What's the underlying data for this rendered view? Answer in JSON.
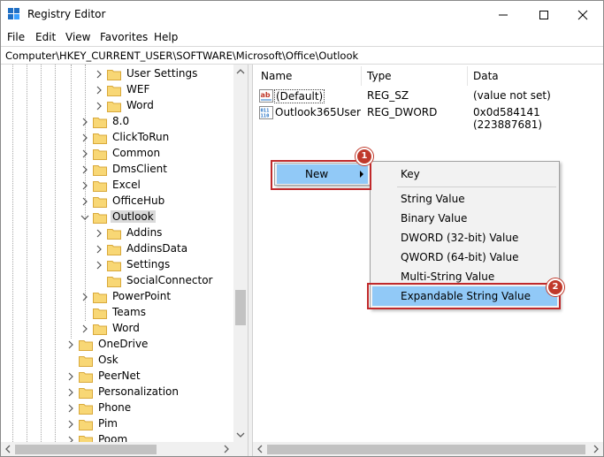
{
  "window": {
    "title": "Registry Editor",
    "app_icon": "registry-editor-icon"
  },
  "menu": [
    "File",
    "Edit",
    "View",
    "Favorites",
    "Help"
  ],
  "address": "Computer\\HKEY_CURRENT_USER\\SOFTWARE\\Microsoft\\Office\\Outlook",
  "tree": {
    "items": [
      {
        "label": "User Settings",
        "expanded": false,
        "level": 3
      },
      {
        "label": "WEF",
        "expanded": false,
        "level": 3
      },
      {
        "label": "Word",
        "expanded": false,
        "level": 3
      },
      {
        "label": "8.0",
        "expanded": false,
        "level": 2
      },
      {
        "label": "ClickToRun",
        "expanded": false,
        "level": 2
      },
      {
        "label": "Common",
        "expanded": false,
        "level": 2
      },
      {
        "label": "DmsClient",
        "expanded": false,
        "level": 2
      },
      {
        "label": "Excel",
        "expanded": false,
        "level": 2
      },
      {
        "label": "OfficeHub",
        "expanded": false,
        "level": 2
      },
      {
        "label": "Outlook",
        "expanded": true,
        "level": 2,
        "selected": true
      },
      {
        "label": "Addins",
        "expanded": false,
        "level": 3
      },
      {
        "label": "AddinsData",
        "expanded": false,
        "level": 3
      },
      {
        "label": "Settings",
        "expanded": false,
        "level": 3
      },
      {
        "label": "SocialConnector",
        "expanded": false,
        "level": 3,
        "leaf": true
      },
      {
        "label": "PowerPoint",
        "expanded": false,
        "level": 2
      },
      {
        "label": "Teams",
        "expanded": false,
        "level": 2,
        "leaf": true
      },
      {
        "label": "Word",
        "expanded": false,
        "level": 2
      },
      {
        "label": "OneDrive",
        "expanded": false,
        "level": 1
      },
      {
        "label": "Osk",
        "expanded": false,
        "level": 1,
        "leaf": true
      },
      {
        "label": "PeerNet",
        "expanded": false,
        "level": 1
      },
      {
        "label": "Personalization",
        "expanded": false,
        "level": 1
      },
      {
        "label": "Phone",
        "expanded": false,
        "level": 1
      },
      {
        "label": "Pim",
        "expanded": false,
        "level": 1
      },
      {
        "label": "Poom",
        "expanded": false,
        "level": 1
      }
    ]
  },
  "list": {
    "columns": {
      "name": "Name",
      "type": "Type",
      "data": "Data"
    },
    "rows": [
      {
        "name": "(Default)",
        "type": "REG_SZ",
        "data": "(value not set)",
        "icon": "string-value-icon"
      },
      {
        "name": "Outlook365User",
        "type": "REG_DWORD",
        "data": "0x0d584141 (223887681)",
        "icon": "binary-value-icon"
      }
    ]
  },
  "context_menu": {
    "new_label": "New",
    "submenu": [
      "Key",
      "String Value",
      "Binary Value",
      "DWORD (32-bit) Value",
      "QWORD (64-bit) Value",
      "Multi-String Value",
      "Expandable String Value"
    ],
    "highlighted": "Expandable String Value"
  },
  "callouts": {
    "step1": "1",
    "step2": "2"
  },
  "colors": {
    "highlight": "#91c9f7",
    "callout": "#c0292b",
    "folder": "#f8d775",
    "selected_tree": "#d9d9d9"
  }
}
